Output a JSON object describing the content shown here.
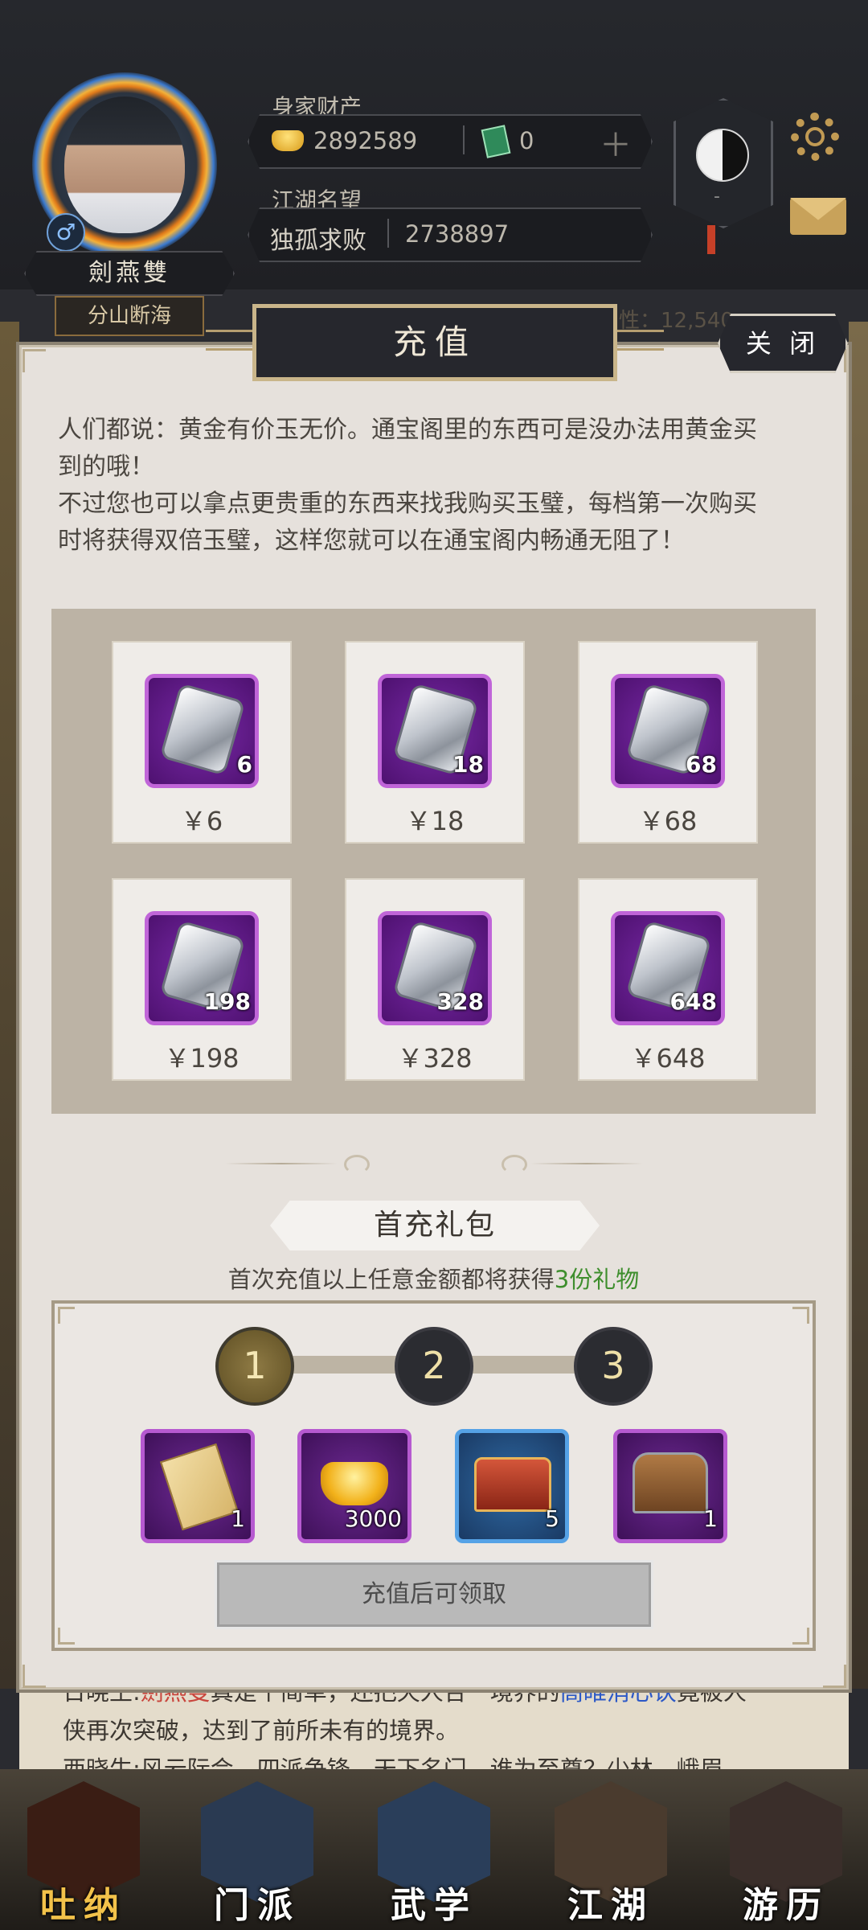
{
  "header": {
    "assets_label": "身家财产",
    "gold_amount": "2892589",
    "jade_amount": "0",
    "plus_icon": "plus-icon",
    "reputation_label": "江湖名望",
    "reputation_title": "独孤求败",
    "reputation_value": "2738897",
    "player_name": "劍燕雙",
    "player_title": "分山断海",
    "taiji_status": "-",
    "partial_bg_text": "性：12,540"
  },
  "dialog": {
    "title": "充值",
    "close_label": "关 闭",
    "intro_line1": "人们都说：黄金有价玉无价。通宝阁里的东西可是没办法用黄金买",
    "intro_line2": "到的哦！",
    "intro_line3": "不过您也可以拿点更贵重的东西来找我购买玉璧，每档第一次购买",
    "intro_line4": "时将获得双倍玉璧，这样您就可以在通宝阁内畅通无阻了！",
    "packs": [
      {
        "count": "6",
        "price": "￥6"
      },
      {
        "count": "18",
        "price": "￥18"
      },
      {
        "count": "68",
        "price": "￥68"
      },
      {
        "count": "198",
        "price": "￥198"
      },
      {
        "count": "328",
        "price": "￥328"
      },
      {
        "count": "648",
        "price": "￥648"
      }
    ],
    "first_charge": {
      "title": "首充礼包",
      "desc_prefix": "首次充值以上任意金额都将获得",
      "desc_highlight": "3份礼物",
      "steps": [
        "1",
        "2",
        "3"
      ],
      "items": [
        {
          "icon": "secret-book-icon",
          "count": "1"
        },
        {
          "icon": "gold-ingot-icon",
          "count": "3000"
        },
        {
          "icon": "red-treasure-chest-icon",
          "count": "5"
        },
        {
          "icon": "wooden-chest-icon",
          "count": "1"
        }
      ],
      "claim_label": "充值后可领取"
    }
  },
  "news": {
    "line1_prefix": "日晓王:",
    "line1_name": "劍燕雙",
    "line1_mid": "真是个简单，还把天人合一境界的",
    "line1_skill": "高睢消心诀",
    "line1_suffix": "竟被人",
    "line2": "侠再次突破，达到了前所未有的境界。",
    "line3": "西晓生:风云际会，四派争锋，天下名门，谁为至尊？少林，峨眉"
  },
  "nav": {
    "items": [
      {
        "label": "吐纳",
        "active": true
      },
      {
        "label": "门派",
        "active": false
      },
      {
        "label": "武学",
        "active": false
      },
      {
        "label": "江湖",
        "active": false
      },
      {
        "label": "游历",
        "active": false
      }
    ]
  },
  "colors": {
    "accent_gold": "#c9b58a",
    "gem_frame_purple": "#c065d8",
    "highlight_green": "#3e8e2d",
    "active_nav": "#f2c24a"
  }
}
